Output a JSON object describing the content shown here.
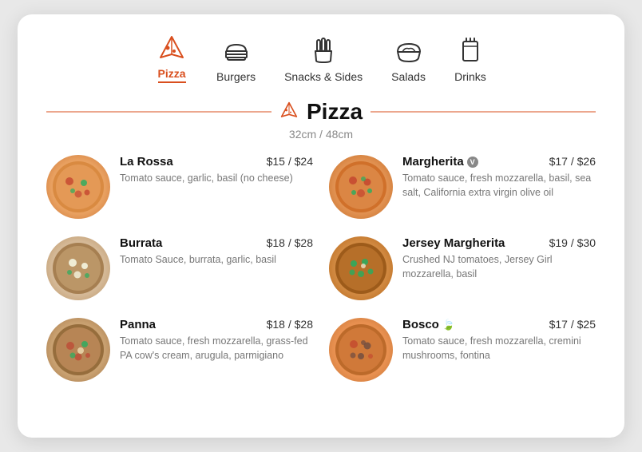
{
  "nav": {
    "items": [
      {
        "id": "pizza",
        "label": "Pizza",
        "active": true
      },
      {
        "id": "burgers",
        "label": "Burgers",
        "active": false
      },
      {
        "id": "snacks",
        "label": "Snacks & Sides",
        "active": false
      },
      {
        "id": "salads",
        "label": "Salads",
        "active": false
      },
      {
        "id": "drinks",
        "label": "Drinks",
        "active": false
      }
    ]
  },
  "section": {
    "title": "Pizza",
    "subtitle": "32cm / 48cm"
  },
  "menu": {
    "items": [
      {
        "id": "la-rossa",
        "name": "La Rossa",
        "price": "$15 / $24",
        "desc": "Tomato sauce, garlic, basil (no cheese)",
        "badge": null,
        "img_class": "p1"
      },
      {
        "id": "margherita",
        "name": "Margherita",
        "price": "$17 / $26",
        "desc": "Tomato sauce, fresh mozzarella, basil, sea salt, California extra virgin olive oil",
        "badge": "V",
        "img_class": "p4"
      },
      {
        "id": "burrata",
        "name": "Burrata",
        "price": "$18 / $28",
        "desc": "Tomato Sauce, burrata, garlic, basil",
        "badge": null,
        "img_class": "p2"
      },
      {
        "id": "jersey-margherita",
        "name": "Jersey Margherita",
        "price": "$19 / $30",
        "desc": "Crushed NJ tomatoes, Jersey Girl mozzarella, basil",
        "badge": null,
        "img_class": "p5"
      },
      {
        "id": "panna",
        "name": "Panna",
        "price": "$18 / $28",
        "desc": "Tomato sauce, fresh mozzarella, grass-fed PA cow's cream, arugula, parmigiano",
        "badge": null,
        "img_class": "p3"
      },
      {
        "id": "bosco",
        "name": "Bosco",
        "price": "$17 / $25",
        "desc": "Tomato sauce, fresh mozzarella, cremini mushrooms, fontina",
        "badge": "leaf",
        "img_class": "p6"
      }
    ]
  }
}
